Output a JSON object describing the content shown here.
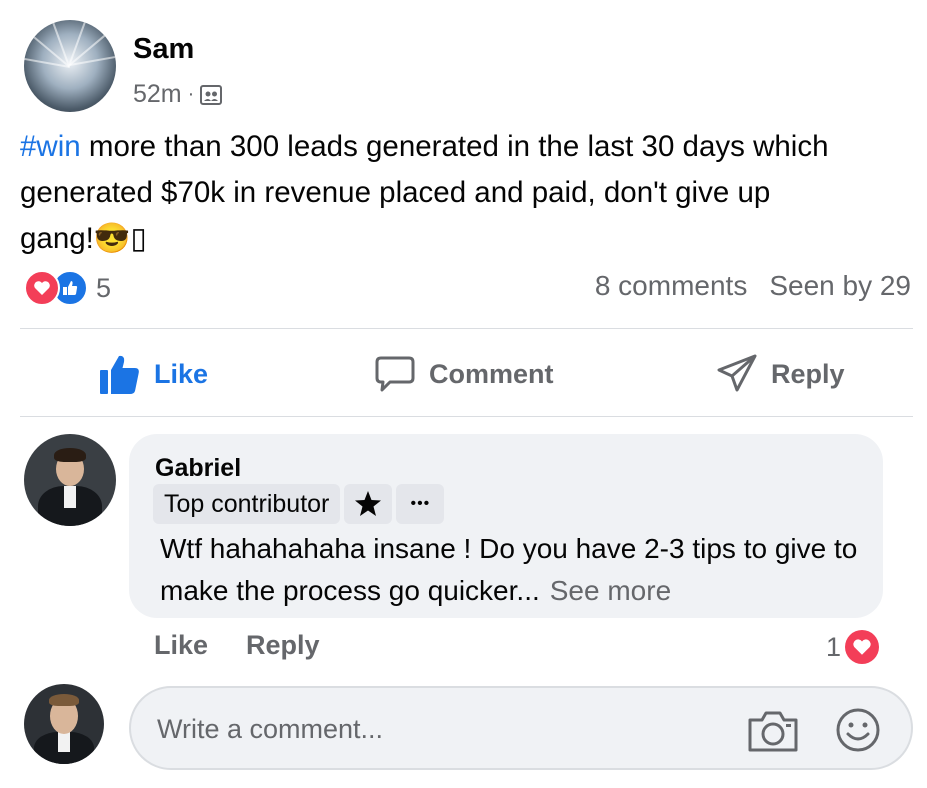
{
  "post": {
    "author": "Sam",
    "time": "52m",
    "separator": "·",
    "audience_icon": "group-audience-icon",
    "hashtag": "#win",
    "text_line1": " more than 300 leads generated in the last 30 days which",
    "text_line2": "generated $70k in revenue placed and paid, don't give up",
    "text_line3": "gang!😎▯",
    "reaction_count": "5",
    "comments": "8 comments",
    "seen_by": "Seen by 29"
  },
  "actions": {
    "like": "Like",
    "comment": "Comment",
    "reply": "Reply"
  },
  "comment": {
    "author": "Gabriel",
    "badge": "Top contributor",
    "more": "•••",
    "text": "Wtf hahahahaha insane ! Do you have 2-3 tips to give to make the process go quicker...",
    "see_more": "See more",
    "like": "Like",
    "reply": "Reply",
    "reaction_count": "1"
  },
  "composer": {
    "placeholder": "Write a comment..."
  },
  "colors": {
    "accent": "#1b74e4",
    "love": "#f33e58",
    "secondary_text": "#65676b",
    "bubble": "#f0f2f5"
  }
}
